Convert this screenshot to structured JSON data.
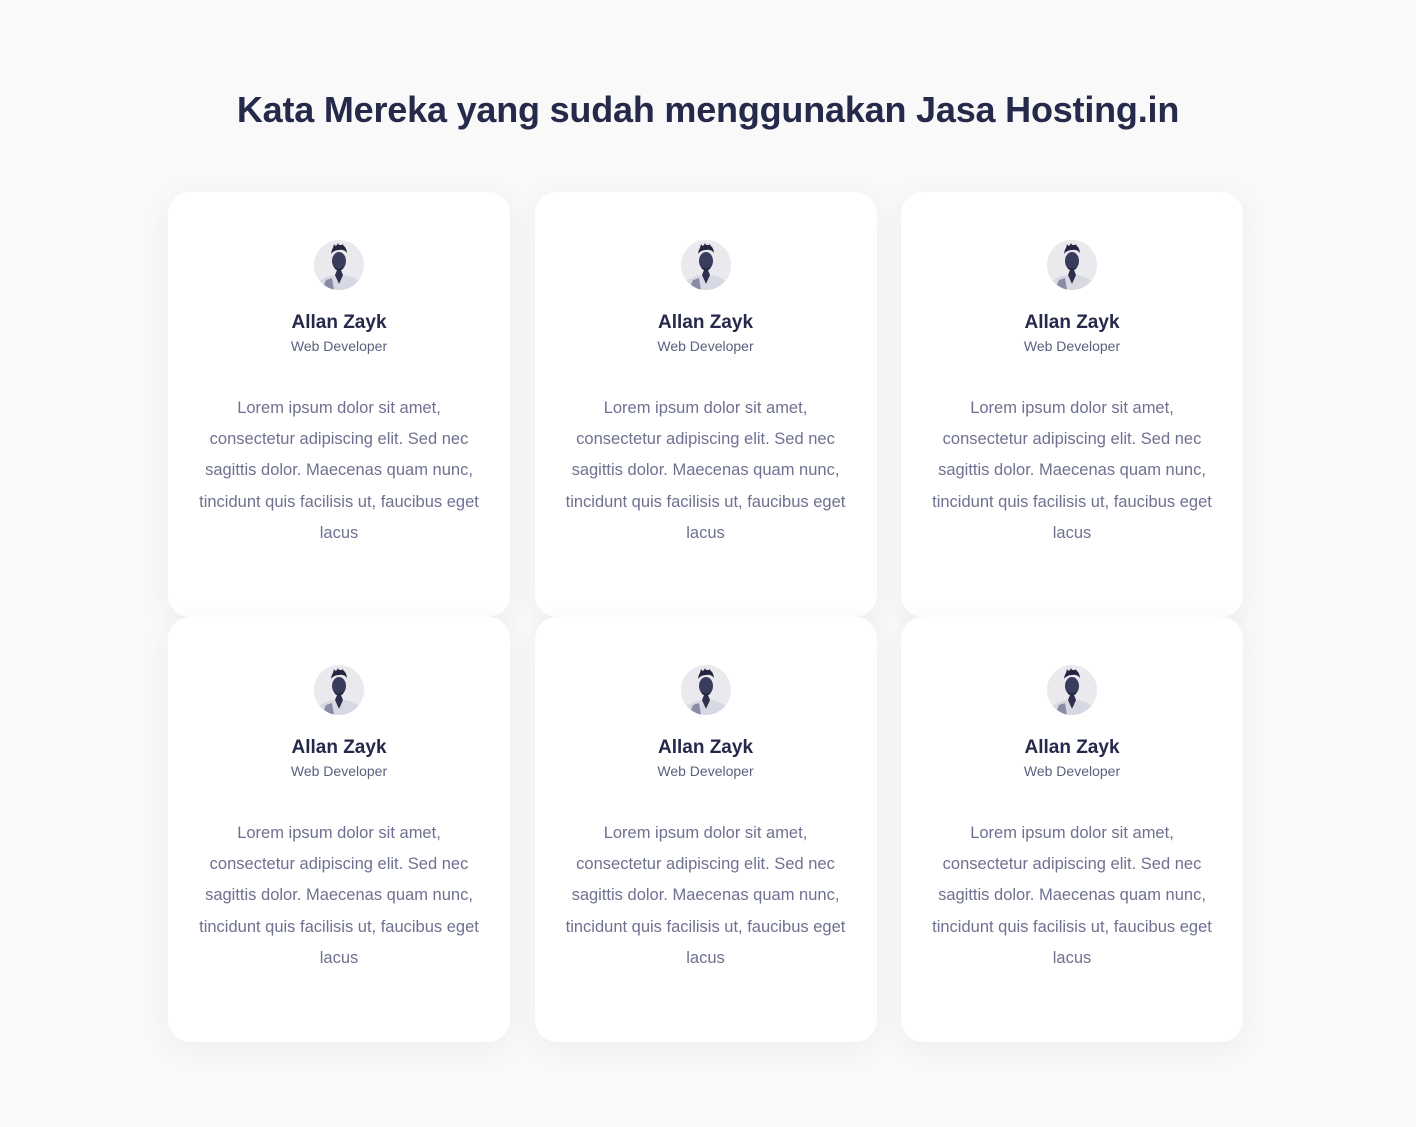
{
  "section": {
    "title": "Kata Mereka yang sudah menggunakan Jasa Hosting.in"
  },
  "testimonials": [
    {
      "avatar_icon": "avatar-portrait-icon",
      "name": "Allan Zayk",
      "role": "Web Developer",
      "quote": "Lorem ipsum dolor sit amet, consectetur adipiscing elit. Sed nec sagittis dolor. Maecenas quam nunc, tincidunt quis facilisis ut, faucibus eget lacus"
    },
    {
      "avatar_icon": "avatar-portrait-icon",
      "name": "Allan Zayk",
      "role": "Web Developer",
      "quote": "Lorem ipsum dolor sit amet, consectetur adipiscing elit. Sed nec sagittis dolor. Maecenas quam nunc, tincidunt quis facilisis ut, faucibus eget lacus"
    },
    {
      "avatar_icon": "avatar-portrait-icon",
      "name": "Allan Zayk",
      "role": "Web Developer",
      "quote": "Lorem ipsum dolor sit amet, consectetur adipiscing elit. Sed nec sagittis dolor. Maecenas quam nunc, tincidunt quis facilisis ut, faucibus eget lacus"
    },
    {
      "avatar_icon": "avatar-portrait-icon",
      "name": "Allan Zayk",
      "role": "Web Developer",
      "quote": "Lorem ipsum dolor sit amet, consectetur adipiscing elit. Sed nec sagittis dolor. Maecenas quam nunc, tincidunt quis facilisis ut, faucibus eget lacus"
    },
    {
      "avatar_icon": "avatar-portrait-icon",
      "name": "Allan Zayk",
      "role": "Web Developer",
      "quote": "Lorem ipsum dolor sit amet, consectetur adipiscing elit. Sed nec sagittis dolor. Maecenas quam nunc, tincidunt quis facilisis ut, faucibus eget lacus"
    },
    {
      "avatar_icon": "avatar-portrait-icon",
      "name": "Allan Zayk",
      "role": "Web Developer",
      "quote": "Lorem ipsum dolor sit amet, consectetur adipiscing elit. Sed nec sagittis dolor. Maecenas quam nunc, tincidunt quis facilisis ut, faucibus eget lacus"
    }
  ],
  "colors": {
    "page_background": "#f9f9f9",
    "card_background": "#ffffff",
    "heading": "#25294a",
    "role_text": "#5a5f7d",
    "body_text": "#6e7191"
  }
}
